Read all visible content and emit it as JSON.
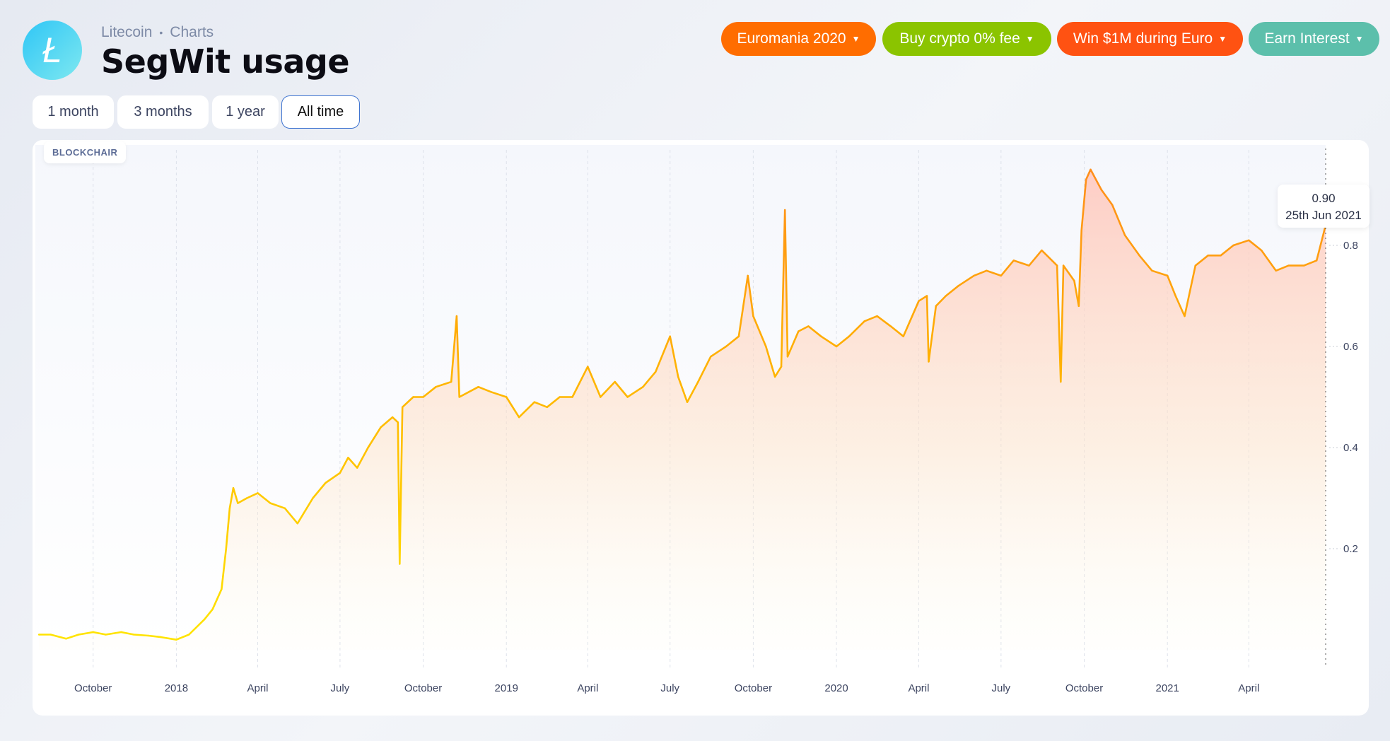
{
  "header": {
    "breadcrumb": [
      "Litecoin",
      "Charts"
    ],
    "title": "SegWit usage",
    "logo_icon": "litecoin-icon"
  },
  "promos": [
    {
      "label": "Euromania 2020",
      "color": "#ff6d00"
    },
    {
      "label": "Buy crypto 0% fee",
      "color": "#8bc400"
    },
    {
      "label": "Win $1M during Euro",
      "color": "#ff5212"
    },
    {
      "label": "Earn Interest",
      "color": "#5cbfab"
    }
  ],
  "ranges": [
    {
      "label": "1 month"
    },
    {
      "label": "3 months"
    },
    {
      "label": "1 year"
    },
    {
      "label": "All time",
      "active": true
    }
  ],
  "watermark": "BLOCKCHAIR",
  "tooltip": {
    "value": "0.90",
    "date": "25th Jun 2021"
  },
  "chart_data": {
    "type": "area",
    "title": "",
    "xlabel": "",
    "ylabel": "",
    "xlim": [
      "2017-08-02",
      "2021-06-25"
    ],
    "ylim": [
      0,
      1
    ],
    "x_ticks": [
      {
        "date": "2017-10-01",
        "label": "October"
      },
      {
        "date": "2018-01-01",
        "label": "2018"
      },
      {
        "date": "2018-04-01",
        "label": "April"
      },
      {
        "date": "2018-07-01",
        "label": "July"
      },
      {
        "date": "2018-10-01",
        "label": "October"
      },
      {
        "date": "2019-01-01",
        "label": "2019"
      },
      {
        "date": "2019-04-01",
        "label": "April"
      },
      {
        "date": "2019-07-01",
        "label": "July"
      },
      {
        "date": "2019-10-01",
        "label": "October"
      },
      {
        "date": "2020-01-01",
        "label": "2020"
      },
      {
        "date": "2020-04-01",
        "label": "April"
      },
      {
        "date": "2020-07-01",
        "label": "July"
      },
      {
        "date": "2020-10-01",
        "label": "October"
      },
      {
        "date": "2021-01-01",
        "label": "2021"
      },
      {
        "date": "2021-04-01",
        "label": "April"
      }
    ],
    "y_ticks": [
      0.2,
      0.4,
      0.6,
      0.8
    ],
    "colors": {
      "low": "#ffe600",
      "high": "#ff8a1f",
      "fill_top": "#ffc4bc"
    },
    "grid": "vertical dashed",
    "series": [
      {
        "points": [
          [
            "2017-08-02",
            0.03
          ],
          [
            "2017-08-15",
            0.03
          ],
          [
            "2017-09-01",
            0.022
          ],
          [
            "2017-09-15",
            0.03
          ],
          [
            "2017-10-01",
            0.035
          ],
          [
            "2017-10-15",
            0.03
          ],
          [
            "2017-11-01",
            0.035
          ],
          [
            "2017-11-15",
            0.03
          ],
          [
            "2017-12-01",
            0.028
          ],
          [
            "2017-12-15",
            0.025
          ],
          [
            "2018-01-01",
            0.02
          ],
          [
            "2018-01-15",
            0.03
          ],
          [
            "2018-02-01",
            0.06
          ],
          [
            "2018-02-10",
            0.08
          ],
          [
            "2018-02-20",
            0.12
          ],
          [
            "2018-02-25",
            0.2
          ],
          [
            "2018-03-01",
            0.28
          ],
          [
            "2018-03-05",
            0.32
          ],
          [
            "2018-03-10",
            0.29
          ],
          [
            "2018-03-20",
            0.3
          ],
          [
            "2018-04-01",
            0.31
          ],
          [
            "2018-04-15",
            0.29
          ],
          [
            "2018-05-01",
            0.28
          ],
          [
            "2018-05-15",
            0.25
          ],
          [
            "2018-06-01",
            0.3
          ],
          [
            "2018-06-15",
            0.33
          ],
          [
            "2018-07-01",
            0.35
          ],
          [
            "2018-07-10",
            0.38
          ],
          [
            "2018-07-20",
            0.36
          ],
          [
            "2018-08-01",
            0.4
          ],
          [
            "2018-08-15",
            0.44
          ],
          [
            "2018-08-28",
            0.46
          ],
          [
            "2018-09-03",
            0.45
          ],
          [
            "2018-09-05",
            0.17
          ],
          [
            "2018-09-08",
            0.48
          ],
          [
            "2018-09-20",
            0.5
          ],
          [
            "2018-10-01",
            0.5
          ],
          [
            "2018-10-15",
            0.52
          ],
          [
            "2018-11-01",
            0.53
          ],
          [
            "2018-11-07",
            0.66
          ],
          [
            "2018-11-10",
            0.5
          ],
          [
            "2018-12-01",
            0.52
          ],
          [
            "2018-12-15",
            0.51
          ],
          [
            "2019-01-01",
            0.5
          ],
          [
            "2019-01-15",
            0.46
          ],
          [
            "2019-02-01",
            0.49
          ],
          [
            "2019-02-15",
            0.48
          ],
          [
            "2019-03-01",
            0.5
          ],
          [
            "2019-03-15",
            0.5
          ],
          [
            "2019-04-01",
            0.56
          ],
          [
            "2019-04-15",
            0.5
          ],
          [
            "2019-05-01",
            0.53
          ],
          [
            "2019-05-15",
            0.5
          ],
          [
            "2019-06-01",
            0.52
          ],
          [
            "2019-06-15",
            0.55
          ],
          [
            "2019-07-01",
            0.62
          ],
          [
            "2019-07-10",
            0.54
          ],
          [
            "2019-07-20",
            0.49
          ],
          [
            "2019-08-01",
            0.53
          ],
          [
            "2019-08-15",
            0.58
          ],
          [
            "2019-09-01",
            0.6
          ],
          [
            "2019-09-15",
            0.62
          ],
          [
            "2019-09-25",
            0.74
          ],
          [
            "2019-10-01",
            0.66
          ],
          [
            "2019-10-15",
            0.6
          ],
          [
            "2019-10-25",
            0.54
          ],
          [
            "2019-11-01",
            0.56
          ],
          [
            "2019-11-05",
            0.87
          ],
          [
            "2019-11-08",
            0.58
          ],
          [
            "2019-11-20",
            0.63
          ],
          [
            "2019-12-01",
            0.64
          ],
          [
            "2019-12-15",
            0.62
          ],
          [
            "2020-01-01",
            0.6
          ],
          [
            "2020-01-15",
            0.62
          ],
          [
            "2020-02-01",
            0.65
          ],
          [
            "2020-02-15",
            0.66
          ],
          [
            "2020-03-01",
            0.64
          ],
          [
            "2020-03-15",
            0.62
          ],
          [
            "2020-04-01",
            0.69
          ],
          [
            "2020-04-10",
            0.7
          ],
          [
            "2020-04-12",
            0.57
          ],
          [
            "2020-04-20",
            0.68
          ],
          [
            "2020-05-01",
            0.7
          ],
          [
            "2020-05-15",
            0.72
          ],
          [
            "2020-06-01",
            0.74
          ],
          [
            "2020-06-15",
            0.75
          ],
          [
            "2020-07-01",
            0.74
          ],
          [
            "2020-07-15",
            0.77
          ],
          [
            "2020-08-01",
            0.76
          ],
          [
            "2020-08-15",
            0.79
          ],
          [
            "2020-09-01",
            0.76
          ],
          [
            "2020-09-05",
            0.53
          ],
          [
            "2020-09-08",
            0.76
          ],
          [
            "2020-09-20",
            0.73
          ],
          [
            "2020-09-25",
            0.68
          ],
          [
            "2020-09-28",
            0.83
          ],
          [
            "2020-10-03",
            0.93
          ],
          [
            "2020-10-08",
            0.95
          ],
          [
            "2020-10-20",
            0.91
          ],
          [
            "2020-11-01",
            0.88
          ],
          [
            "2020-11-15",
            0.82
          ],
          [
            "2020-12-01",
            0.78
          ],
          [
            "2020-12-15",
            0.75
          ],
          [
            "2021-01-01",
            0.74
          ],
          [
            "2021-01-10",
            0.7
          ],
          [
            "2021-01-20",
            0.66
          ],
          [
            "2021-02-01",
            0.76
          ],
          [
            "2021-02-15",
            0.78
          ],
          [
            "2021-03-01",
            0.78
          ],
          [
            "2021-03-15",
            0.8
          ],
          [
            "2021-04-01",
            0.81
          ],
          [
            "2021-04-15",
            0.79
          ],
          [
            "2021-05-01",
            0.75
          ],
          [
            "2021-05-15",
            0.76
          ],
          [
            "2021-06-01",
            0.76
          ],
          [
            "2021-06-15",
            0.77
          ],
          [
            "2021-06-25",
            0.84
          ]
        ]
      }
    ]
  }
}
